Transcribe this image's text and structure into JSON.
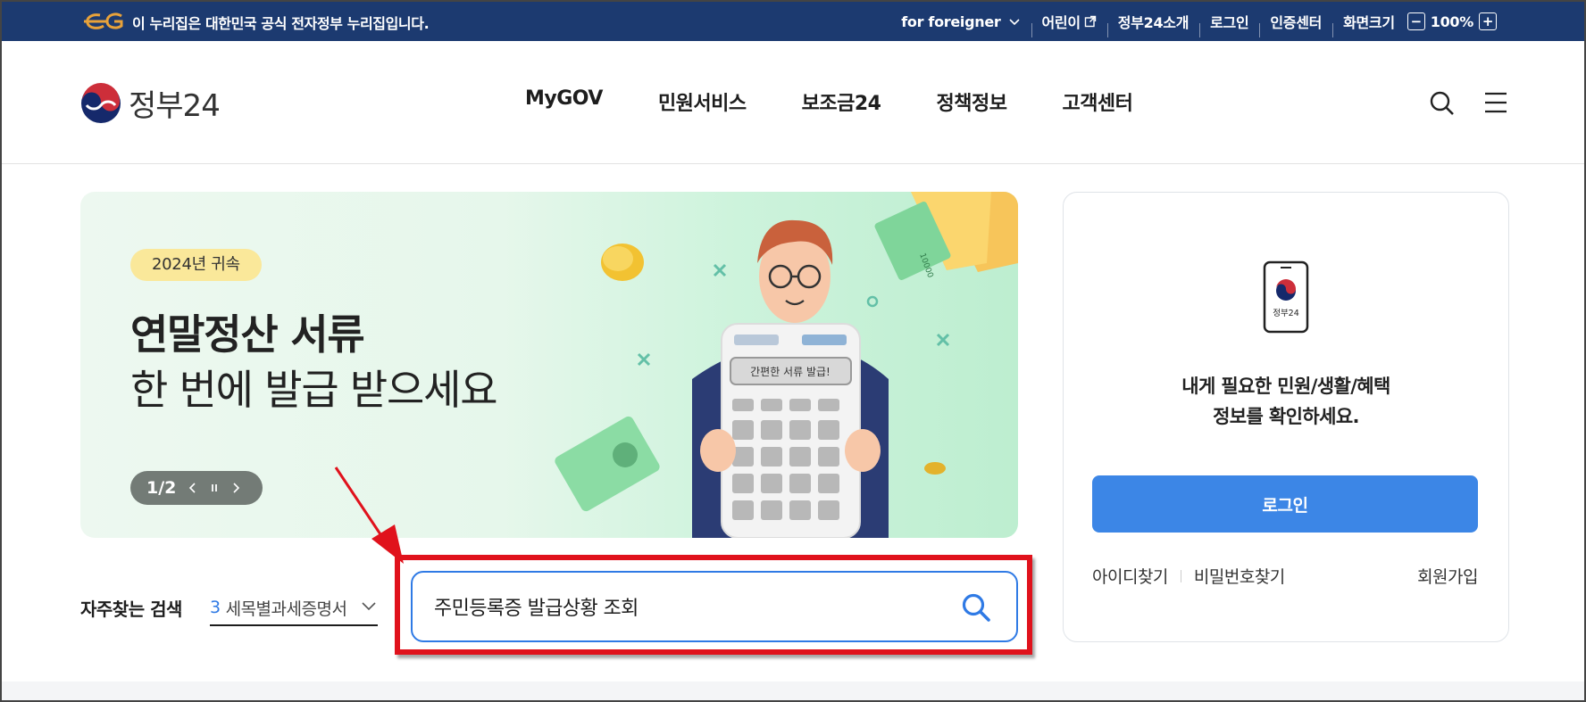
{
  "topbar": {
    "notice": "이 누리집은 대한민국 공식 전자정부 누리집입니다.",
    "foreigner": "for foreigner",
    "kids": "어린이",
    "about": "정부24소개",
    "login": "로그인",
    "cert": "인증센터",
    "zoom_label": "화면크기",
    "zoom_minus": "−",
    "zoom_value": "100%",
    "zoom_plus": "+"
  },
  "header": {
    "logo_text": "정부24",
    "nav": [
      "MyGOV",
      "민원서비스",
      "보조금24",
      "정책정보",
      "고객센터"
    ]
  },
  "banner": {
    "badge": "2024년 귀속",
    "title": "연말정산 서류",
    "subtitle": "한 번에 발급 받으세요",
    "pager": "1/2",
    "calc_label": "간편한 서류 발급!",
    "money_label": "10000"
  },
  "search": {
    "freq_label": "자주찾는 검색",
    "freq_num": "3",
    "freq_item": "세목별과세증명서",
    "value": "주민등록증 발급상황 조회"
  },
  "login_card": {
    "phone_label": "정부24",
    "message_line1": "내게 필요한 민원/생활/혜택",
    "message_line2": "정보를 확인하세요.",
    "login_button": "로그인",
    "find_id": "아이디찾기",
    "find_pw": "비밀번호찾기",
    "signup": "회원가입"
  },
  "colors": {
    "topbar_bg": "#1c3a70",
    "accent_blue": "#2f7ae5",
    "login_button": "#3c86e6",
    "highlight_red": "#e0121c",
    "badge_yellow": "#fae89a"
  }
}
